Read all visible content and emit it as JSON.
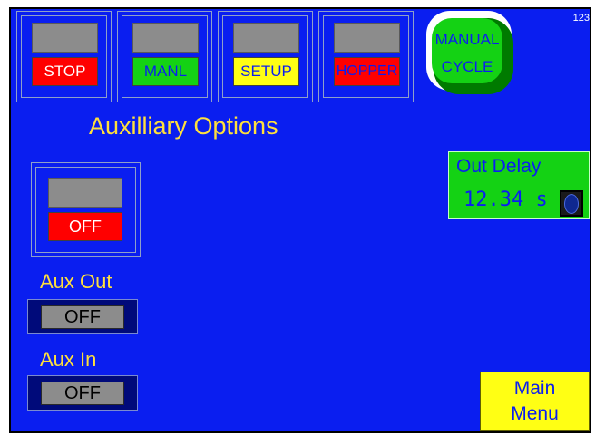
{
  "header": {
    "corner_label": "123",
    "buttons": [
      {
        "label": "STOP",
        "bg": "#ff0000",
        "fg": "#ffffff"
      },
      {
        "label": "MANL",
        "bg": "#14d214",
        "fg": "#0a1ef0"
      },
      {
        "label": "SETUP",
        "bg": "#ffff14",
        "fg": "#0a1ef0"
      },
      {
        "label": "HOPPER",
        "bg": "#ff0000",
        "fg": "#0a1ef0"
      }
    ],
    "manual_cycle": {
      "line1": "MANUAL",
      "line2": "CYCLE"
    }
  },
  "main": {
    "title": "Auxilliary Options",
    "main_toggle_state": "OFF",
    "aux_out": {
      "label": "Aux Out",
      "value": "OFF"
    },
    "aux_in": {
      "label": "Aux In",
      "value": "OFF"
    },
    "out_delay": {
      "label": "Out Delay",
      "value": "12.34 s"
    },
    "main_menu": {
      "line1": "Main",
      "line2": "Menu"
    }
  },
  "colors": {
    "background": "#0a1ef0",
    "label_yellow": "#ffe03c",
    "green": "#14d214",
    "red": "#ff0000",
    "yellow": "#ffff14"
  }
}
